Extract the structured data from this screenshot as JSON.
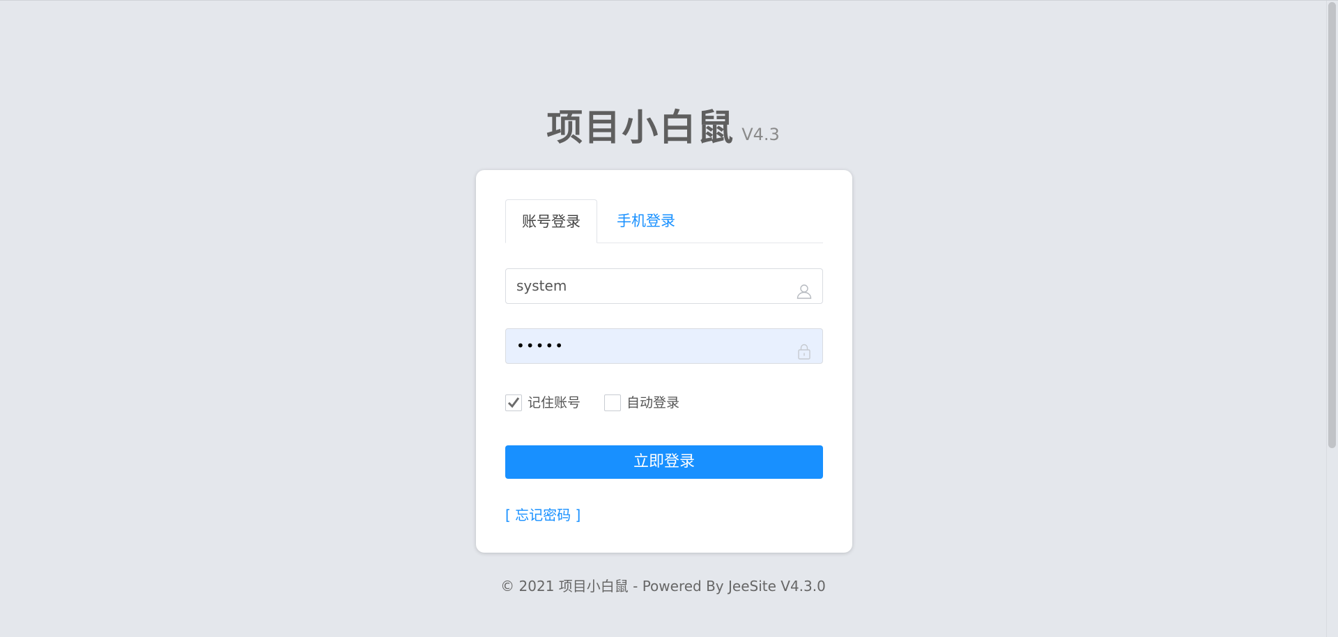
{
  "header": {
    "title": "项目小白鼠",
    "version": "V4.3"
  },
  "tabs": [
    {
      "label": "账号登录",
      "active": true
    },
    {
      "label": "手机登录",
      "active": false
    }
  ],
  "form": {
    "username_value": "system",
    "username_icon": "user-icon",
    "password_value": "•••••",
    "password_icon": "lock-icon",
    "remember_label": "记住账号",
    "remember_checked": true,
    "auto_login_label": "自动登录",
    "auto_login_checked": false,
    "submit_label": "立即登录",
    "forgot_label": "[ 忘记密码 ]"
  },
  "footer": {
    "text": "© 2021 项目小白鼠 - Powered By JeeSite V4.3.0"
  },
  "colors": {
    "background": "#e4e7ec",
    "accent": "#1890ff",
    "password_autofill": "#e8f0fe"
  }
}
